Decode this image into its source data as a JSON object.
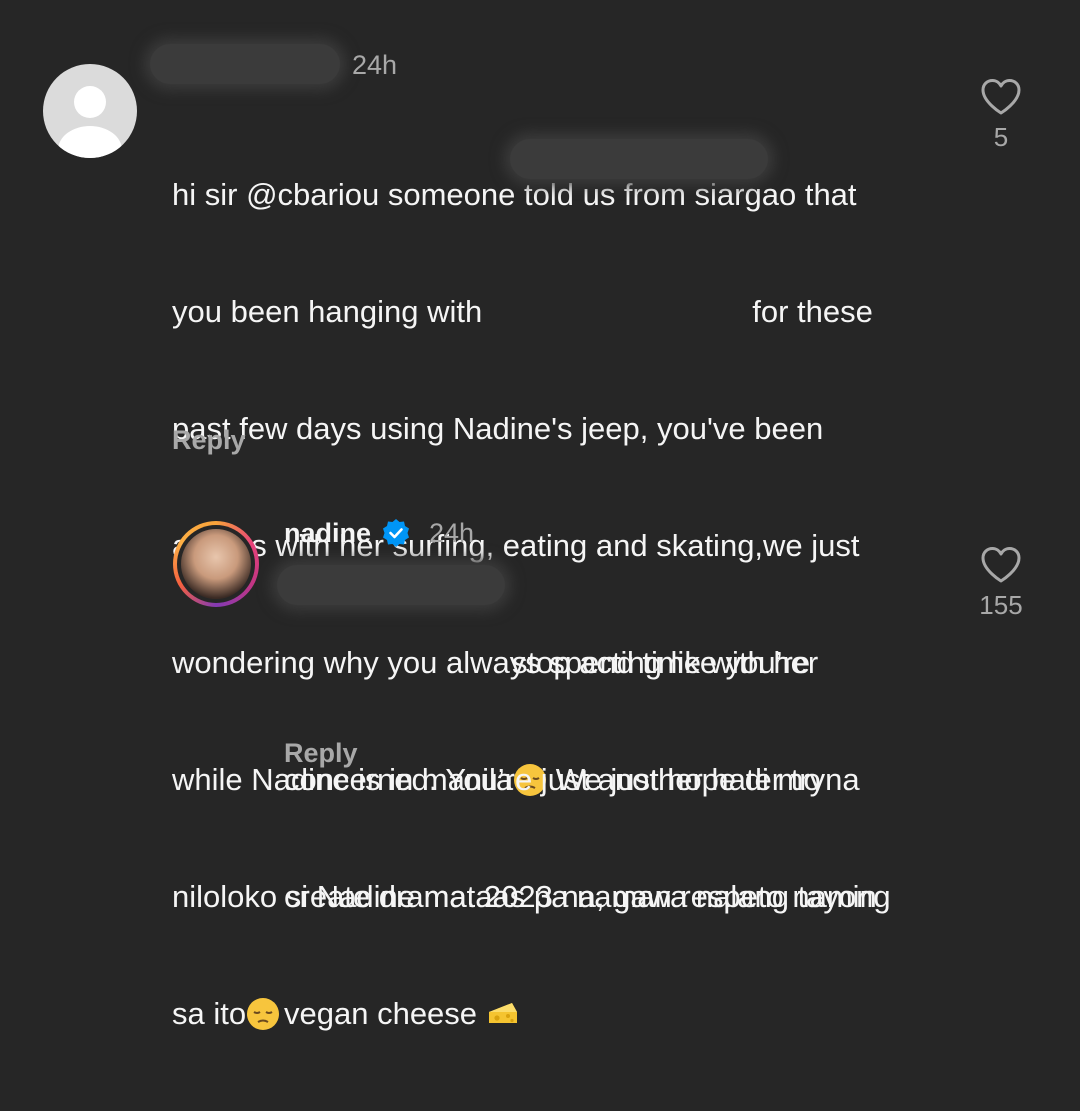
{
  "comment1": {
    "username": "",
    "time": "24h",
    "lines": [
      [
        "hi sir ",
        "@cbariou",
        " someone told us from siargao that"
      ],
      [
        "you been hanging with ",
        "",
        "for these"
      ],
      [
        "past few days using Nadine's jeep, you've been"
      ],
      [
        "always with her surfing, eating and skating,we just"
      ],
      [
        "wondering why you always spend time with her"
      ],
      [
        "while Nadine is in manila",
        " We just hope di mo"
      ],
      [
        "niloloko si Nadine mataas pa naman respeto namin"
      ],
      [
        "sa ito"
      ]
    ],
    "line1_pre": "hi sir ",
    "line1_mention": "@cbariou",
    "line1_post": " someone told us from siargao that",
    "line2_pre": "you been hanging with",
    "line2_post": "for these",
    "line3": "past few days using Nadine's jeep, you've been",
    "line4": "always with her surfing, eating and skating,we just",
    "line5": "wondering why you always spend time with her",
    "line6_pre": "while Nadine is in manila",
    "line6_post": " We just hope di mo",
    "line7": "niloloko si Nadine mataas pa naman respeto namin",
    "line8": "sa ito",
    "emoji_name": "pensive-face-icon",
    "reply_label": "Reply",
    "like_count": "5"
  },
  "comment2": {
    "username": "nadine",
    "verified": true,
    "time": "24h",
    "line1_post": "stop acting like you’re",
    "line2": "concerned. You’re just another hater tryna",
    "line3": "create drama. 2023 na, gawa nalang tayong",
    "line4": "vegan cheese ",
    "emoji_name": "cheese-icon",
    "reply_label": "Reply",
    "like_count": "155"
  },
  "colors": {
    "background": "#262626",
    "text": "#f5f5f5",
    "secondary_text": "#a8a8a8",
    "verified_blue": "#0095f6"
  }
}
